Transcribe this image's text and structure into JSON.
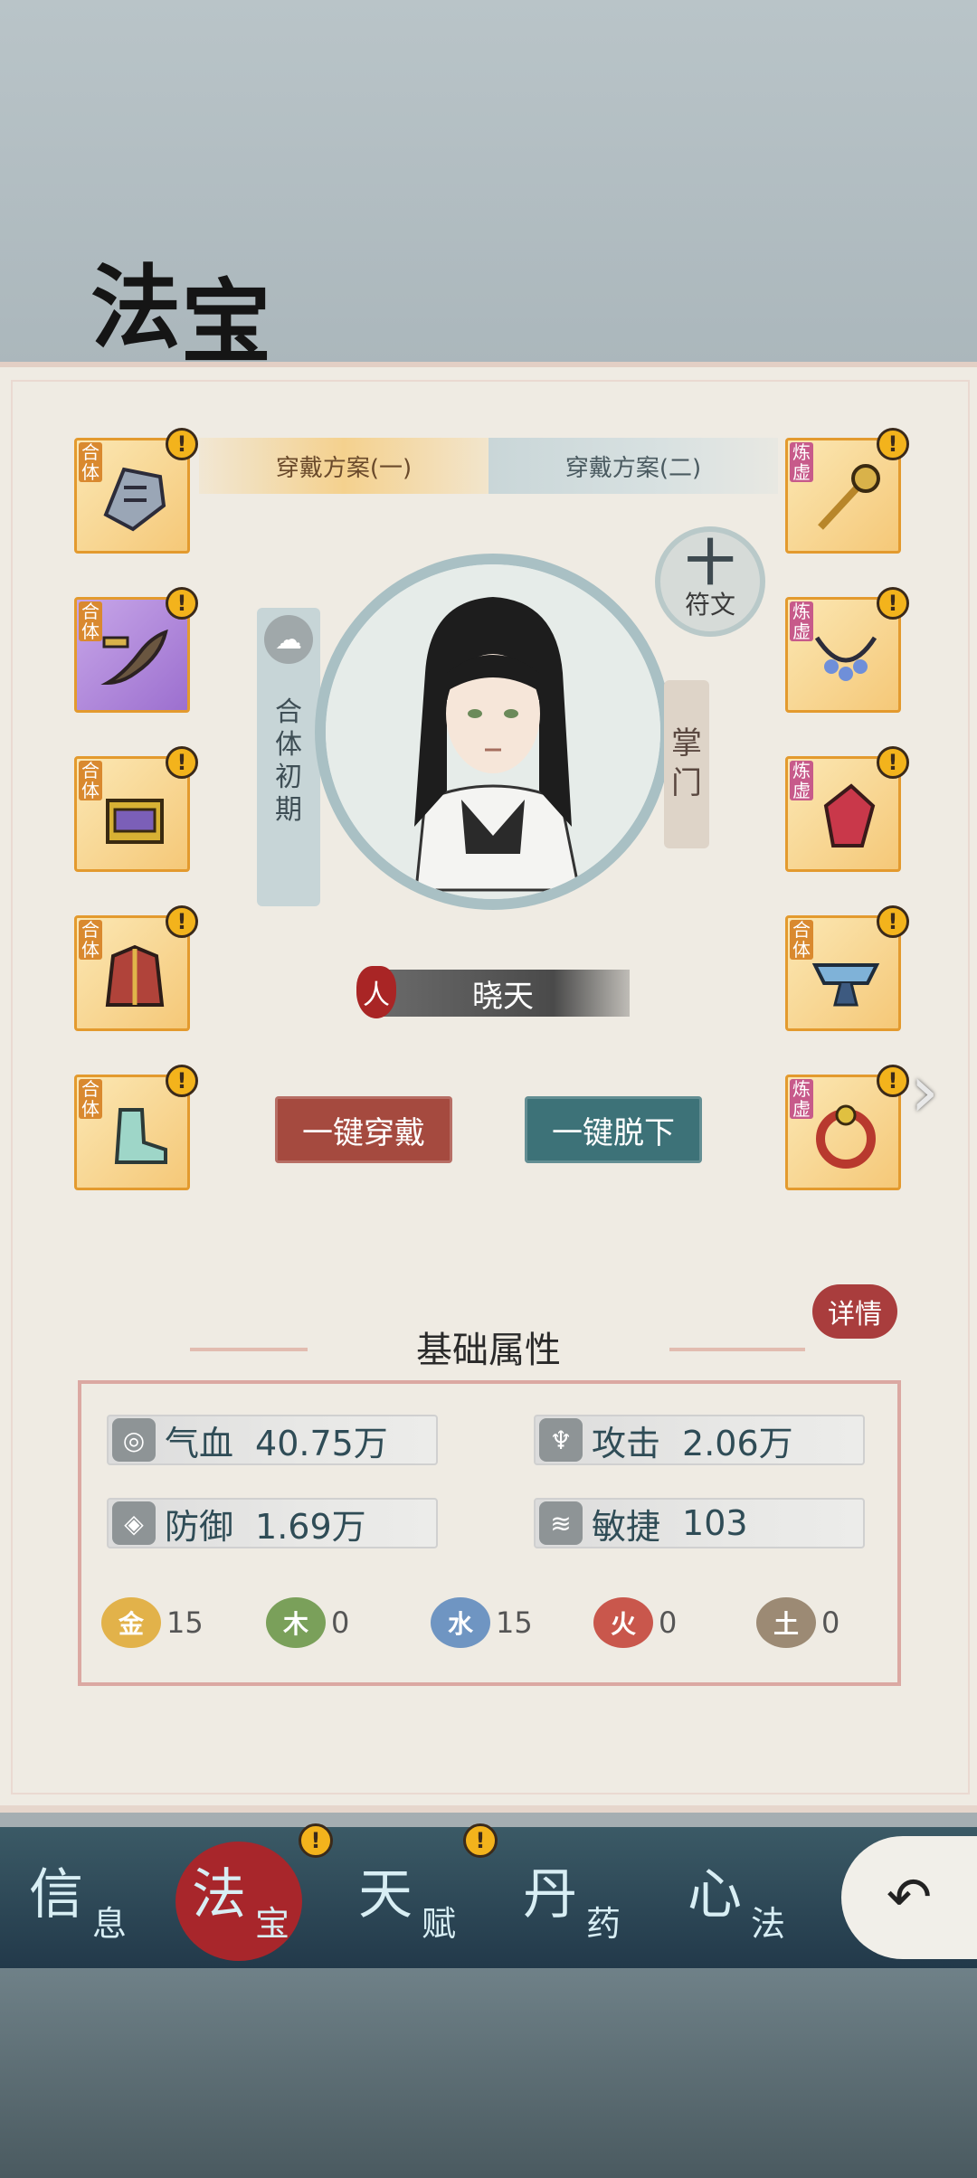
{
  "header": {
    "title_chars": [
      "法",
      "宝"
    ]
  },
  "plan_tabs": [
    {
      "label": "穿戴方案(一)"
    },
    {
      "label": "穿戴方案(二)"
    }
  ],
  "left_slots": [
    {
      "tag": "合体",
      "item": "shield-fan-icon"
    },
    {
      "tag": "合体",
      "item": "curved-blade-icon"
    },
    {
      "tag": "合体",
      "item": "golden-chest-icon"
    },
    {
      "tag": "合体",
      "item": "robe-armor-icon"
    },
    {
      "tag": "合体",
      "item": "boot-icon"
    }
  ],
  "right_slots": [
    {
      "tag": "炼虚",
      "item": "staff-icon"
    },
    {
      "tag": "炼虚",
      "item": "necklace-icon"
    },
    {
      "tag": "炼虚",
      "item": "gem-crystal-icon"
    },
    {
      "tag": "合体",
      "item": "belt-icon"
    },
    {
      "tag": "炼虚",
      "item": "ring-icon"
    }
  ],
  "slot_alert": "!",
  "portrait": {
    "realm": "合体初期",
    "role": "掌门",
    "rune_button": {
      "icon": "十",
      "label": "符文"
    },
    "race": "人",
    "name": "晓天"
  },
  "actions": {
    "equip_all": "一键穿戴",
    "unequip_all": "一键脱下"
  },
  "next_arrow": "›",
  "attributes": {
    "section_title": "基础属性",
    "detail_button": "详情",
    "stats": [
      {
        "label": "气血",
        "value": "40.75万",
        "icon": "blood-drop-icon",
        "glyph": "◎"
      },
      {
        "label": "攻击",
        "value": "2.06万",
        "icon": "attack-icon",
        "glyph": "♆"
      },
      {
        "label": "防御",
        "value": "1.69万",
        "icon": "shield-icon",
        "glyph": "◈"
      },
      {
        "label": "敏捷",
        "value": "103",
        "icon": "agility-icon",
        "glyph": "≋"
      }
    ],
    "elements": [
      {
        "name": "金",
        "glyph": "金",
        "value": "15",
        "color": "#e2b24a"
      },
      {
        "name": "木",
        "glyph": "木",
        "value": "0",
        "color": "#7aa05a"
      },
      {
        "name": "水",
        "glyph": "水",
        "value": "15",
        "color": "#6f95c2"
      },
      {
        "name": "火",
        "glyph": "火",
        "value": "0",
        "color": "#c9574c"
      },
      {
        "name": "土",
        "glyph": "土",
        "value": "0",
        "color": "#9c8a74"
      }
    ]
  },
  "nav": [
    {
      "big": "信",
      "small": "息",
      "alert": false,
      "active": false
    },
    {
      "big": "法",
      "small": "宝",
      "alert": true,
      "active": true
    },
    {
      "big": "天",
      "small": "赋",
      "alert": true,
      "active": false
    },
    {
      "big": "丹",
      "small": "药",
      "alert": false,
      "active": false
    },
    {
      "big": "心",
      "small": "法",
      "alert": false,
      "active": false
    }
  ],
  "back_button": "↶"
}
